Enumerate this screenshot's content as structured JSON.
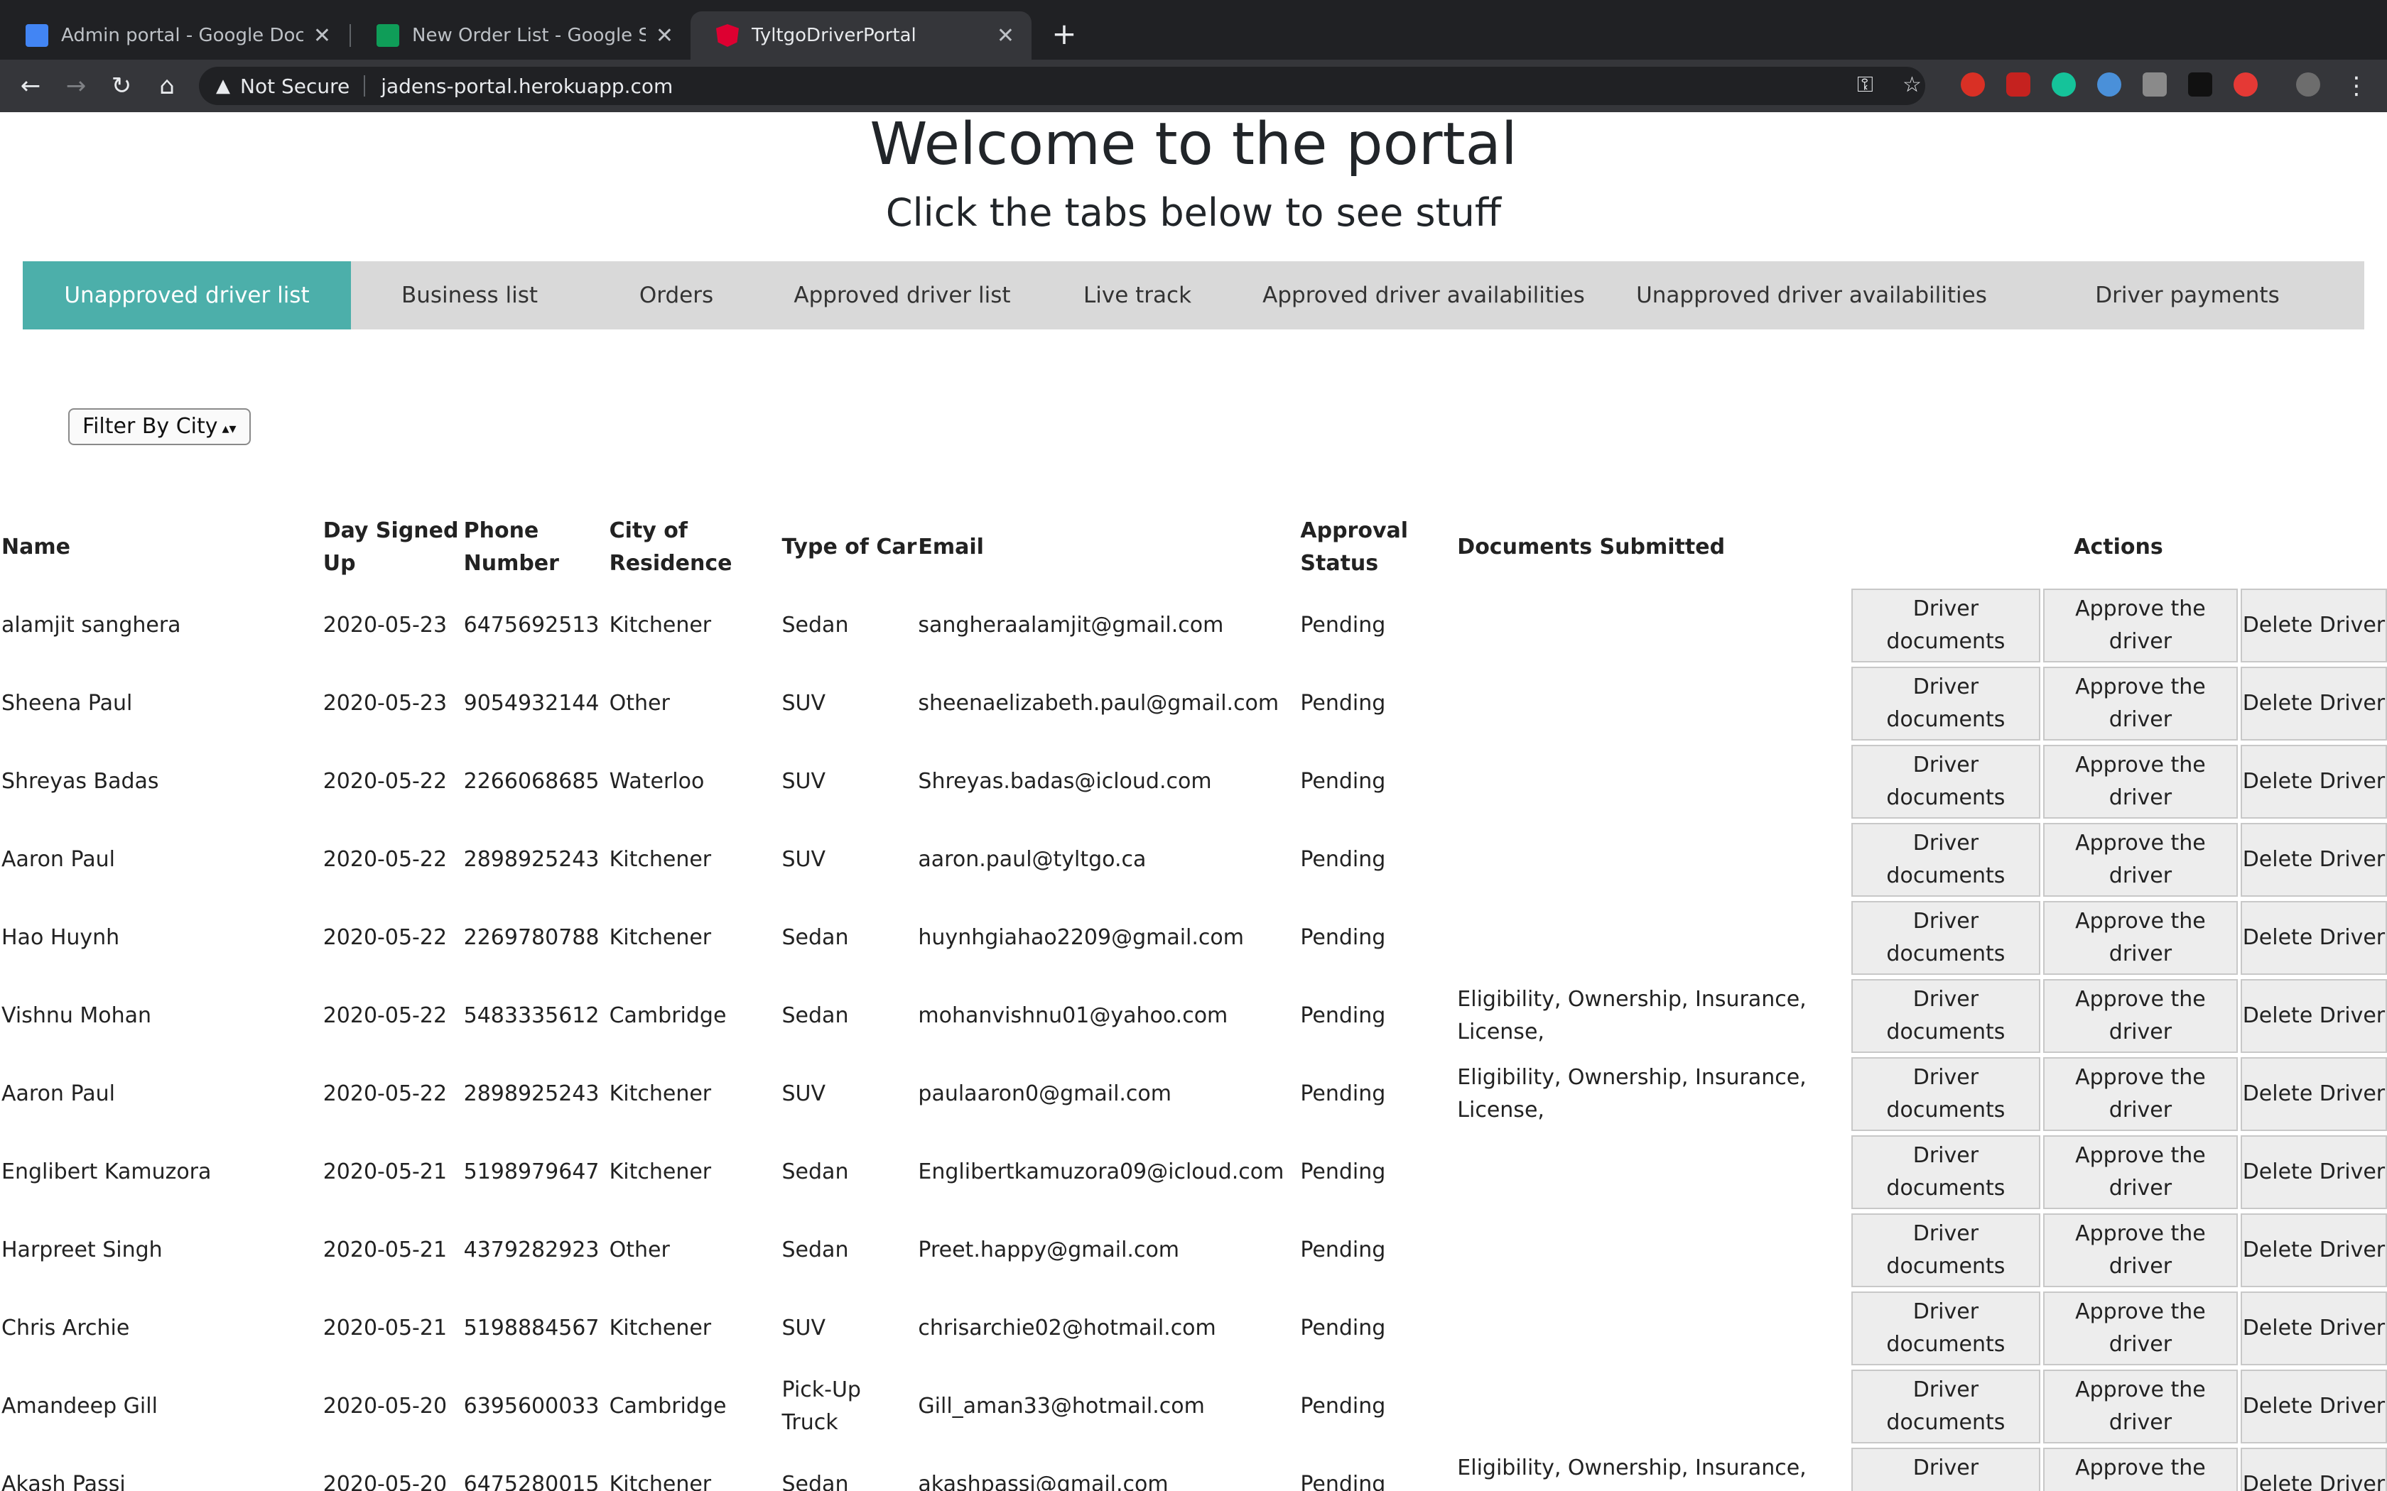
{
  "browser": {
    "tabs": [
      {
        "title": "Admin portal - Google Docs",
        "favicon": "google-docs-icon",
        "color": "#4285f4"
      },
      {
        "title": "New Order List - Google Sheets",
        "favicon": "google-sheets-icon",
        "color": "#0f9d58"
      },
      {
        "title": "TyltgoDriverPortal",
        "favicon": "angular-icon",
        "color": "#dd0031"
      }
    ],
    "security_label": "Not Secure",
    "url": "jadens-portal.herokuapp.com"
  },
  "page": {
    "title": "Welcome to the portal",
    "subtitle": "Click the tabs below to see stuff",
    "accent_color": "#4cafaa"
  },
  "nav_tabs": [
    "Unapproved driver list",
    "Business list",
    "Orders",
    "Approved driver list",
    "Live track",
    "Approved driver availabilities",
    "Unapproved driver availabilities",
    "Driver payments"
  ],
  "filter": {
    "label": "Filter By City"
  },
  "table": {
    "headers": {
      "name": "Name",
      "day": "Day Signed Up",
      "phone": "Phone Number",
      "city": "City of Residence",
      "car": "Type of Car",
      "email": "Email",
      "status": "Approval Status",
      "docs": "Documents Submitted",
      "actions": "Actions"
    },
    "buttons": {
      "docs": "Driver documents",
      "approve": "Approve the driver",
      "delete": "Delete Driver"
    },
    "rows": [
      {
        "name": "alamjit sanghera",
        "day": "2020-05-23",
        "phone": "6475692513",
        "city": "Kitchener",
        "car": "Sedan",
        "email": "sangheraalamjit@gmail.com",
        "status": "Pending",
        "docs": ""
      },
      {
        "name": "Sheena Paul",
        "day": "2020-05-23",
        "phone": "9054932144",
        "city": "Other",
        "car": "SUV",
        "email": "sheenaelizabeth.paul@gmail.com",
        "status": "Pending",
        "docs": ""
      },
      {
        "name": "Shreyas Badas",
        "day": "2020-05-22",
        "phone": "2266068685",
        "city": "Waterloo",
        "car": "SUV",
        "email": "Shreyas.badas@icloud.com",
        "status": "Pending",
        "docs": ""
      },
      {
        "name": "Aaron Paul",
        "day": "2020-05-22",
        "phone": "2898925243",
        "city": "Kitchener",
        "car": "SUV",
        "email": "aaron.paul@tyltgo.ca",
        "status": "Pending",
        "docs": ""
      },
      {
        "name": "Hao Huynh",
        "day": "2020-05-22",
        "phone": "2269780788",
        "city": "Kitchener",
        "car": "Sedan",
        "email": "huynhgiahao2209@gmail.com",
        "status": "Pending",
        "docs": ""
      },
      {
        "name": "Vishnu Mohan",
        "day": "2020-05-22",
        "phone": "5483335612",
        "city": "Cambridge",
        "car": "Sedan",
        "email": "mohanvishnu01@yahoo.com",
        "status": "Pending",
        "docs": "Eligibility, Ownership, Insurance, License,"
      },
      {
        "name": "Aaron Paul",
        "day": "2020-05-22",
        "phone": "2898925243",
        "city": "Kitchener",
        "car": "SUV",
        "email": "paulaaron0@gmail.com",
        "status": "Pending",
        "docs": "Eligibility, Ownership, Insurance, License,"
      },
      {
        "name": "Englibert Kamuzora",
        "day": "2020-05-21",
        "phone": "5198979647",
        "city": "Kitchener",
        "car": "Sedan",
        "email": "Englibertkamuzora09@icloud.com",
        "status": "Pending",
        "docs": ""
      },
      {
        "name": "Harpreet Singh",
        "day": "2020-05-21",
        "phone": "4379282923",
        "city": "Other",
        "car": "Sedan",
        "email": "Preet.happy@gmail.com",
        "status": "Pending",
        "docs": ""
      },
      {
        "name": "Chris Archie",
        "day": "2020-05-21",
        "phone": "5198884567",
        "city": "Kitchener",
        "car": "SUV",
        "email": "chrisarchie02@hotmail.com",
        "status": "Pending",
        "docs": ""
      },
      {
        "name": "Amandeep Gill",
        "day": "2020-05-20",
        "phone": "6395600033",
        "city": "Cambridge",
        "car": "Pick-Up Truck",
        "email": "Gill_aman33@hotmail.com",
        "status": "Pending",
        "docs": ""
      },
      {
        "name": "Akash Passi",
        "day": "2020-05-20",
        "phone": "6475280015",
        "city": "Kitchener",
        "car": "Sedan",
        "email": "akashpassi@gmail.com",
        "status": "Pending",
        "docs": "Eligibility, Ownership, Insurance, License,"
      }
    ]
  }
}
